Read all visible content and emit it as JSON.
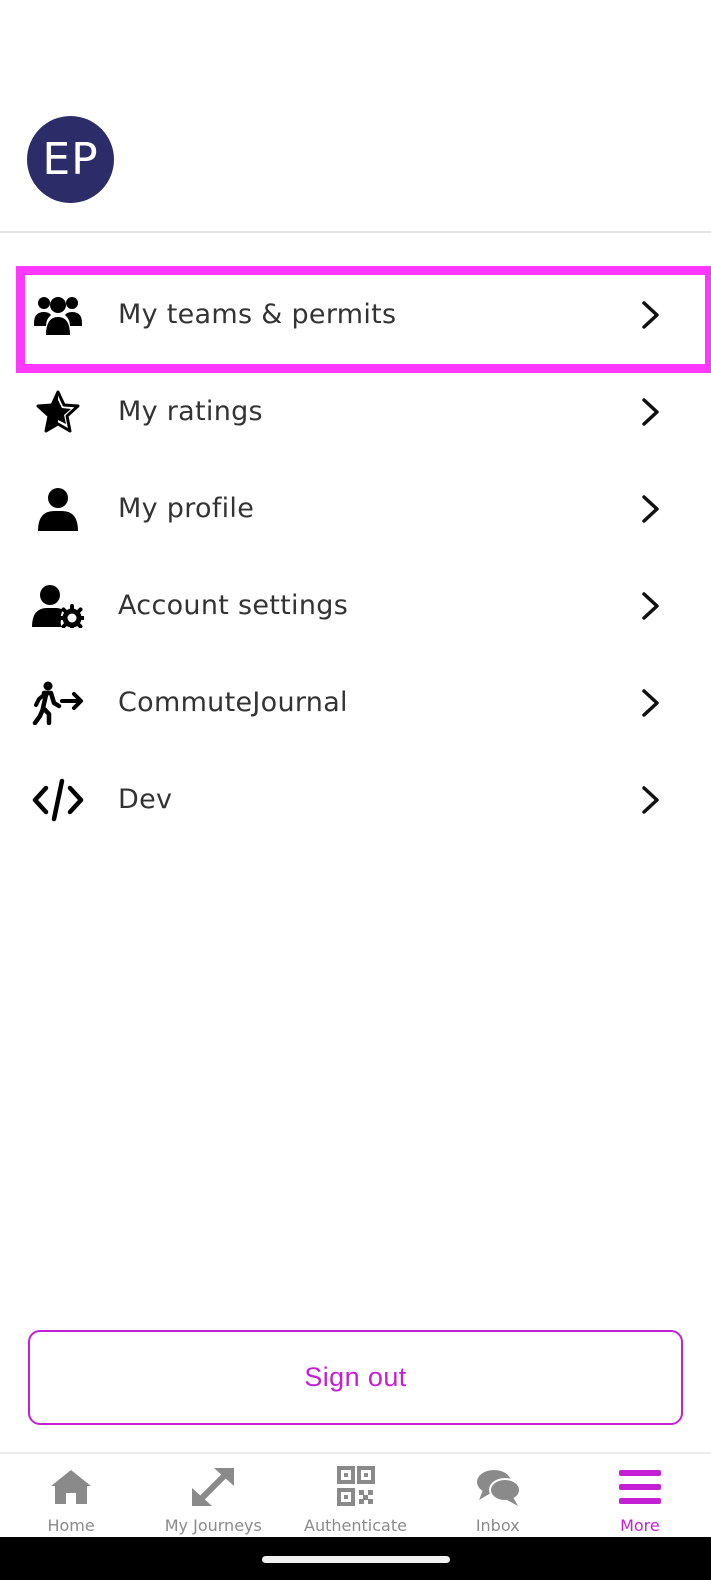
{
  "profile": {
    "initials": "EP"
  },
  "menu": {
    "items": [
      {
        "label": "My teams & permits",
        "icon": "users-icon"
      },
      {
        "label": "My ratings",
        "icon": "star-half-icon"
      },
      {
        "label": "My profile",
        "icon": "user-icon"
      },
      {
        "label": "Account settings",
        "icon": "user-gear-icon"
      },
      {
        "label": "CommuteJournal",
        "icon": "walking-arrow-icon"
      },
      {
        "label": "Dev",
        "icon": "code-icon"
      }
    ]
  },
  "actions": {
    "sign_out": "Sign out"
  },
  "tabs": [
    {
      "label": "Home",
      "icon": "home-icon"
    },
    {
      "label": "My Journeys",
      "icon": "expand-arrows-icon"
    },
    {
      "label": "Authenticate",
      "icon": "qr-code-icon"
    },
    {
      "label": "Inbox",
      "icon": "chat-bubbles-icon"
    },
    {
      "label": "More",
      "icon": "menu-icon"
    }
  ],
  "colors": {
    "accent": "#c51fd6",
    "highlight": "#ff38ff",
    "avatar_bg": "#2c2c68",
    "tab_inactive": "#8a8a8a"
  }
}
